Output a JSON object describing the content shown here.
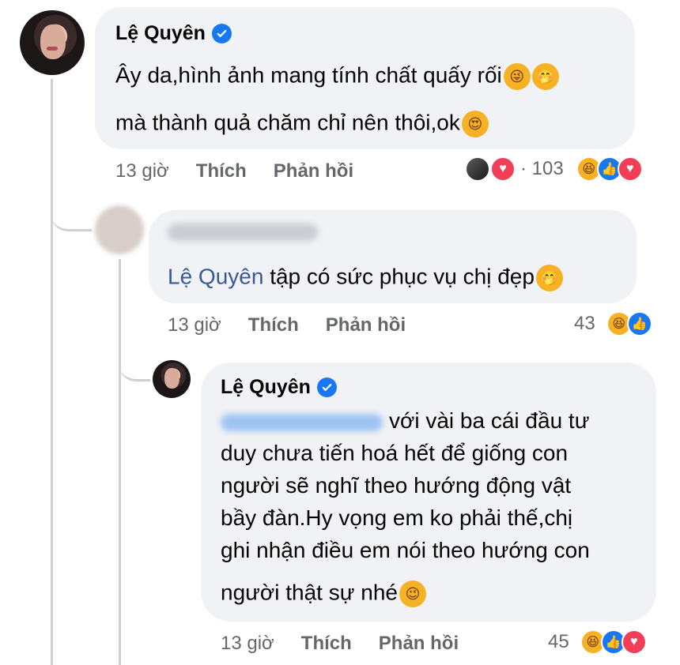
{
  "comments": [
    {
      "author": "Lệ Quyên",
      "lines": [
        "Ây da,hình ảnh mang tính chất quấy rối",
        "mà thành quả chăm chỉ nên thôi,ok"
      ],
      "time": "13 giờ",
      "like_label": "Thích",
      "reply_label": "Phản hồi",
      "reaction_count": "· 103"
    },
    {
      "mention": "Lệ Quyên",
      "text": "tập có sức phục vụ chị đẹp",
      "time": "13 giờ",
      "like_label": "Thích",
      "reply_label": "Phản hồi",
      "reaction_count": "43"
    },
    {
      "author": "Lệ Quyên",
      "lines": [
        "với vài ba cái đầu tư",
        "duy chưa tiến hoá hết để giống con",
        "người sẽ nghĩ theo hướng động vật",
        "bầy đàn.Hy vọng em ko phải thế,chị",
        "ghi nhận điều em nói theo hướng con",
        "người thật sự nhé"
      ],
      "time": "13 giờ",
      "like_label": "Thích",
      "reply_label": "Phản hồi",
      "reaction_count": "45"
    }
  ],
  "colors": {
    "bubble": "#f0f2f5",
    "meta": "#65676b",
    "mention": "#385898",
    "verified": "#1877f2"
  }
}
